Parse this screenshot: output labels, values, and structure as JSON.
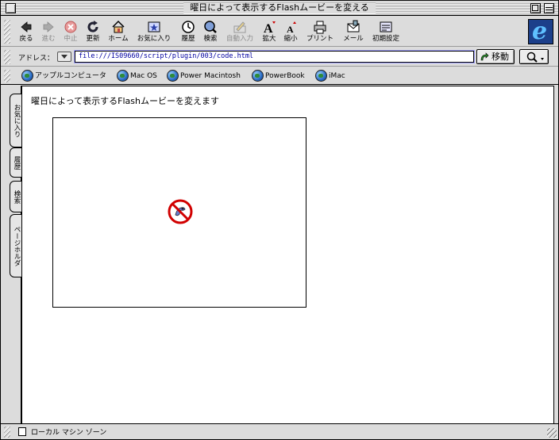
{
  "window": {
    "title": "曜日によって表示するFlashムービーを変える"
  },
  "toolbar": {
    "buttons": [
      {
        "label": "戻る",
        "icon": "back-arrow-icon",
        "enabled": true
      },
      {
        "label": "進む",
        "icon": "forward-arrow-icon",
        "enabled": false
      },
      {
        "label": "中止",
        "icon": "stop-icon",
        "enabled": false
      },
      {
        "label": "更新",
        "icon": "refresh-icon",
        "enabled": true
      },
      {
        "label": "ホーム",
        "icon": "home-icon",
        "enabled": true
      },
      {
        "label": "お気に入り",
        "icon": "favorites-icon",
        "enabled": true
      },
      {
        "label": "履歴",
        "icon": "history-icon",
        "enabled": true
      },
      {
        "label": "検索",
        "icon": "search-icon",
        "enabled": true
      },
      {
        "label": "自動入力",
        "icon": "autofill-icon",
        "enabled": false
      },
      {
        "label": "拡大",
        "icon": "text-larger-icon",
        "enabled": true
      },
      {
        "label": "縮小",
        "icon": "text-smaller-icon",
        "enabled": true
      },
      {
        "label": "プリント",
        "icon": "print-icon",
        "enabled": true
      },
      {
        "label": "メール",
        "icon": "mail-icon",
        "enabled": true
      },
      {
        "label": "初期設定",
        "icon": "preferences-icon",
        "enabled": true
      }
    ]
  },
  "address": {
    "label": "アドレス：",
    "url": "file:///IS09660/script/plugin/003/code.html",
    "go_label": "移動"
  },
  "favorites": [
    {
      "label": "アップルコンピュータ"
    },
    {
      "label": "Mac OS"
    },
    {
      "label": "Power Macintosh"
    },
    {
      "label": "PowerBook"
    },
    {
      "label": "iMac"
    }
  ],
  "side_tabs": [
    "お気に入り",
    "履歴",
    "検索",
    "ページホルダ"
  ],
  "page": {
    "heading": "曜日によって表示するFlashムービーを変えます"
  },
  "status": {
    "text": "ローカル マシン ゾーン"
  },
  "colors": {
    "accent_blue": "#1c3f8a",
    "plugin_missing_red": "#d10000"
  }
}
